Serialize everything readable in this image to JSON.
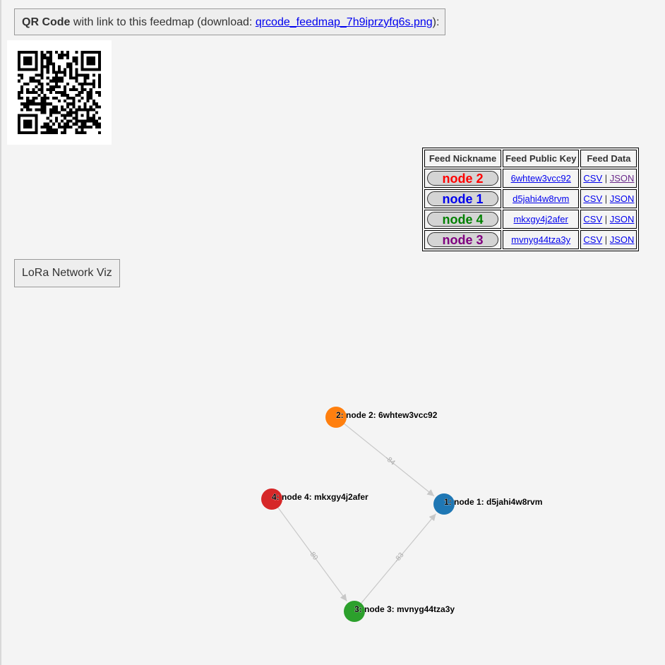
{
  "qr": {
    "caption_bold": "QR Code",
    "caption_text": " with link to this feedmap (download: ",
    "download_link": "qrcode_feedmap_7h9iprzyfq6s.png",
    "caption_end": "):"
  },
  "table": {
    "headers": [
      "Feed Nickname",
      "Feed Public Key",
      "Feed Data"
    ],
    "rows": [
      {
        "nickname": "node 2",
        "color": "#ff0000",
        "key": "6whtew3vcc92",
        "csv": "CSV",
        "sep": "|",
        "json": "JSON",
        "json_visited": true
      },
      {
        "nickname": "node 1",
        "color": "#0000ee",
        "key": "d5jahi4w8rvm",
        "csv": "CSV",
        "sep": "|",
        "json": "JSON",
        "json_visited": false
      },
      {
        "nickname": "node 4",
        "color": "#008000",
        "key": "mkxgy4j2afer",
        "csv": "CSV",
        "sep": "|",
        "json": "JSON",
        "json_visited": false
      },
      {
        "nickname": "node 3",
        "color": "#800080",
        "key": "mvnyg44tza3y",
        "csv": "CSV",
        "sep": "|",
        "json": "JSON",
        "json_visited": false
      }
    ]
  },
  "viz": {
    "caption": "LoRa Network Viz",
    "nodes": [
      {
        "id": "2",
        "label": "2: node 2: 6whtew3vcc92",
        "color": "#ff7f0e"
      },
      {
        "id": "1",
        "label": "1: node 1: d5jahi4w8rvm",
        "color": "#1f77b4"
      },
      {
        "id": "4",
        "label": "4: node 4: mkxgy4j2afer",
        "color": "#d62728"
      },
      {
        "id": "3",
        "label": "3: node 3: mvnyg44tza3y",
        "color": "#2ca02c"
      }
    ],
    "edges": [
      {
        "from": "2",
        "to": "1",
        "label": "-84"
      },
      {
        "from": "4",
        "to": "3",
        "label": "-80"
      },
      {
        "from": "3",
        "to": "1",
        "label": "-83"
      }
    ]
  }
}
